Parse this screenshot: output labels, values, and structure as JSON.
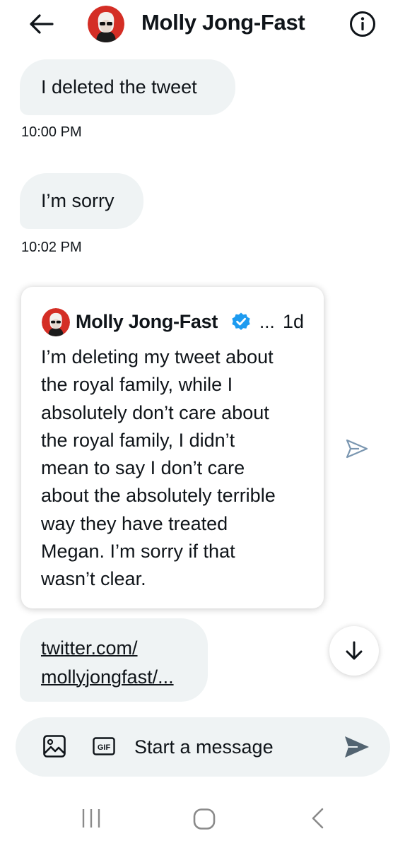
{
  "header": {
    "title": "Molly Jong-Fast",
    "back_icon": "arrow-left-icon",
    "info_icon": "info-circle-icon"
  },
  "messages": [
    {
      "text": "I deleted the tweet",
      "time": "10:00 PM"
    },
    {
      "text": "I’m sorry",
      "time": "10:02 PM"
    }
  ],
  "quoted_tweet": {
    "author": "Molly Jong-Fast",
    "more": "...",
    "age": "1d",
    "lines": [
      "I’m deleting my tweet about",
      "the royal family, while I",
      "absolutely don’t care about",
      "the royal family, I didn’t",
      "mean to say I don’t care",
      "about the absolutely terrible",
      "way they have treated",
      "Megan. I’m sorry if that",
      "wasn’t clear."
    ]
  },
  "link_message": {
    "line1": "twitter.com/",
    "line2": "mollyjongfast/..."
  },
  "composer": {
    "placeholder": "Start a message",
    "gif_label": "GIF"
  },
  "colors": {
    "bubble_bg": "#eff3f4",
    "verified_blue": "#1d9bf0",
    "send_gray": "#536471",
    "nav_gray": "#8a8a8a",
    "share_gray": "#7a96b0"
  }
}
